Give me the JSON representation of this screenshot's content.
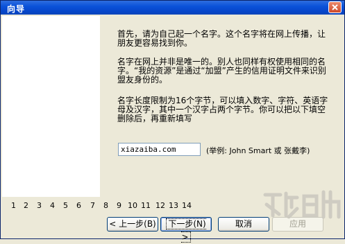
{
  "window": {
    "title": "向导"
  },
  "intro": {
    "para1": "首先，请为自己起一个名字。这个名字将在网上传播，让朋友更容易找到你。",
    "para2": "名字在网上并非是唯一的。别人也同样有权使用相同的名字。“我的资源”是通过“加盟”产生的信用证明文件来识别盟友身份的。",
    "para3": "名字长度限制为16个字节，可以填入数字、字符、英语字母及汉字，其中一个汉字占两个字节。你可以把以下填空删除后，再重新填写"
  },
  "name_field": {
    "value": "xiazaiba.com",
    "example": "(举例: John Smart 或 张戴李)"
  },
  "steps": [
    "1",
    "2",
    "3",
    "4",
    "5",
    "6",
    "7",
    "8",
    "9",
    "10",
    "11",
    "12",
    "13",
    "14"
  ],
  "buttons": {
    "back": "< 上一步(B)",
    "next": "下一步(N) >",
    "cancel": "取消",
    "apply": "应用"
  },
  "colors": {
    "titlebar": "#0b52d9",
    "panel": "#ffffff",
    "window_bg": "#ece9d8"
  },
  "icons": [
    "close-icon",
    "watermark-logo"
  ]
}
